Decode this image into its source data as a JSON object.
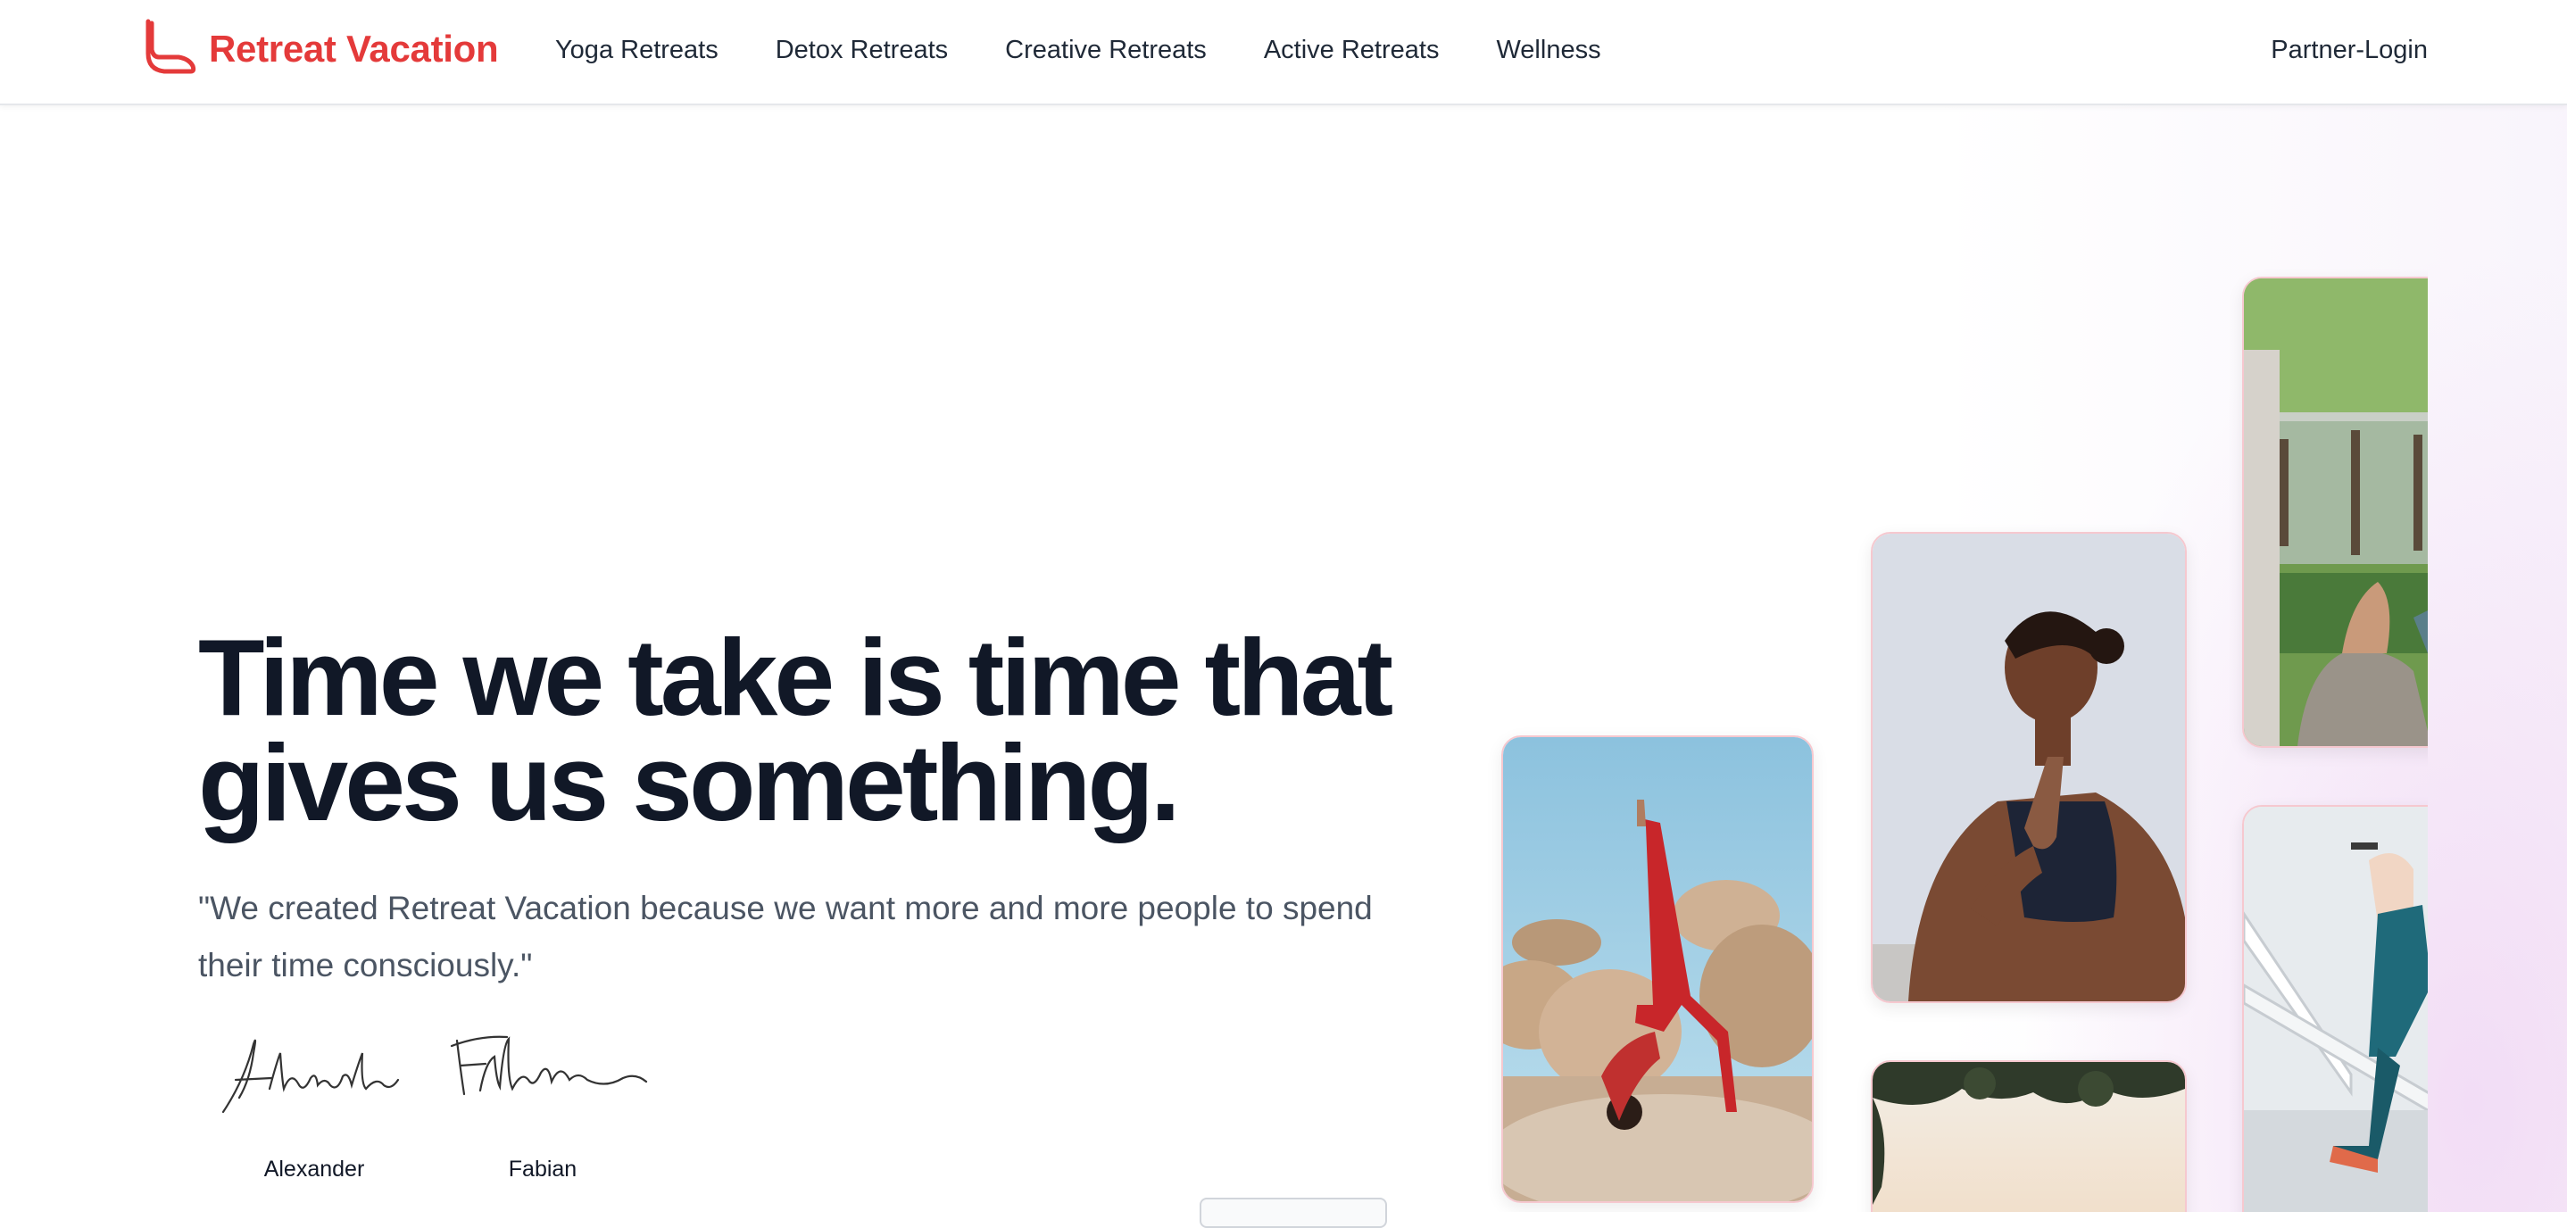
{
  "brand": {
    "name": "Retreat Vacation",
    "logo_icon": "ribbon-logo-icon",
    "color": "#e43a3a"
  },
  "nav": {
    "links": [
      "Yoga Retreats",
      "Detox Retreats",
      "Creative Retreats",
      "Active Retreats",
      "Wellness"
    ],
    "partner_login": "Partner-Login"
  },
  "hero": {
    "headline": "Time we take is time that gives us something.",
    "quote": "\"We created Retreat Vacation because we want more and more people to spend their time consciously.\"",
    "signatures": [
      {
        "name": "Alexander",
        "signature_text": "Alexander"
      },
      {
        "name": "Fabian",
        "signature_text": "Fabian"
      }
    ]
  },
  "photos": [
    {
      "subject": "woman-yoga-pose-on-rocks"
    },
    {
      "subject": "woman-meditating-namaste"
    },
    {
      "subject": "trees-and-sunset"
    },
    {
      "subject": "person-drawing-in-park"
    },
    {
      "subject": "woman-jogging-on-bridge"
    }
  ],
  "colors": {
    "text": "#111827",
    "muted": "#4b5563",
    "accent": "#e43a3a",
    "card_border": "#f6c8cf"
  }
}
